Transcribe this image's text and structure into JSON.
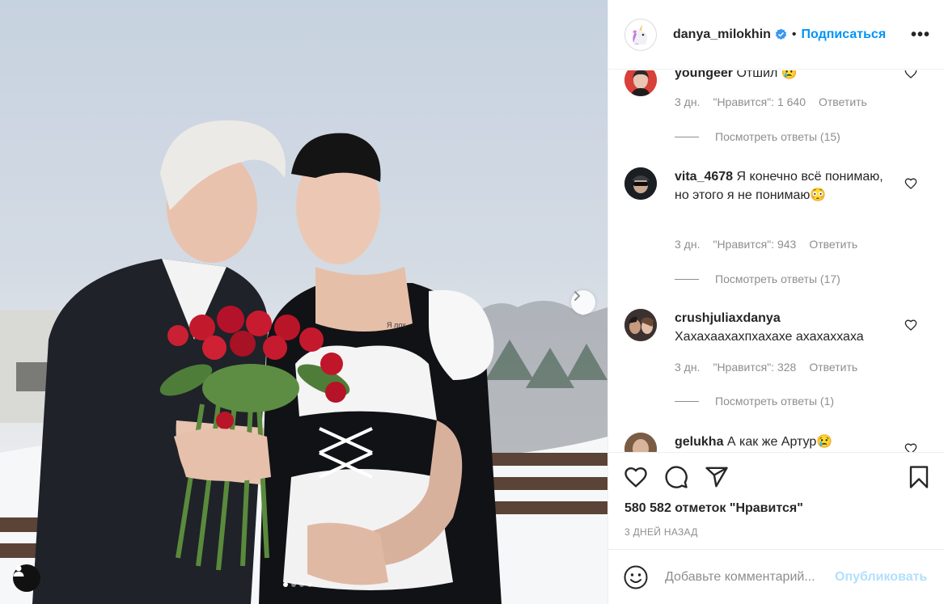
{
  "post": {
    "author": "danya_milokhin",
    "separator": "•",
    "follow_label": "Подписаться",
    "more_label": "•••",
    "photo_text": "Я лох",
    "likes_text": "580 582 отметок \"Нравится\"",
    "date_text": "3 ДНЕЙ НАЗАД"
  },
  "comments": [
    {
      "user": "youngeer",
      "text": "Отшил 😢",
      "time": "3 дн.",
      "likes": "\"Нравится\": 1 640",
      "reply": "Ответить",
      "replies": "Посмотреть ответы (15)"
    },
    {
      "user": "vita_4678",
      "text": "Я конечно всё понимаю, но этого я не понимаю😳",
      "time": "3 дн.",
      "likes": "\"Нравится\": 943",
      "reply": "Ответить",
      "replies": "Посмотреть ответы (17)"
    },
    {
      "user": "crushjuliaxdanya",
      "text": "Хахахаахахпхахахе ахахаххаха",
      "time": "3 дн.",
      "likes": "\"Нравится\": 328",
      "reply": "Ответить",
      "replies": "Посмотреть ответы (1)"
    },
    {
      "user": "gelukha",
      "text": "А как же Артур😢"
    }
  ],
  "composer": {
    "placeholder": "Добавьте комментарий...",
    "publish_label": "Опубликовать"
  },
  "icons": [
    "unicorn-icon",
    "verified-icon",
    "heart-icon",
    "comment-icon",
    "share-icon",
    "bookmark-icon",
    "emoji-icon",
    "chevron-right-icon",
    "user-tag-icon"
  ],
  "colors": {
    "link_blue": "#0095f6",
    "publish_disabled": "#b2dffc",
    "secondary_text": "#8e8e8e",
    "border": "#efefef"
  }
}
